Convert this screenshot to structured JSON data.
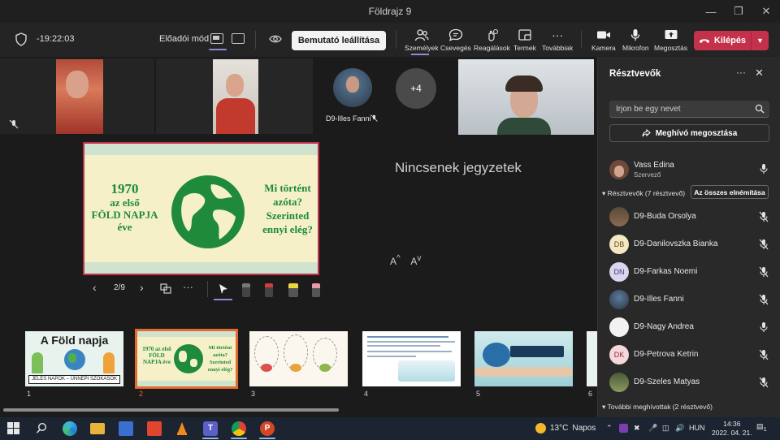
{
  "window": {
    "title": "Földrajz 9",
    "controls": [
      "minimize-icon",
      "restore-icon",
      "close-icon"
    ]
  },
  "toolbar": {
    "timer": "-19:22:03",
    "presenter_mode_label": "Előadói mód",
    "stop_presenting": "Bemutató leállítása",
    "items": [
      {
        "icon": "people-icon",
        "label": "Személyek"
      },
      {
        "icon": "chat-icon",
        "label": "Csevegés"
      },
      {
        "icon": "reactions-icon",
        "label": "Reagálások"
      },
      {
        "icon": "rooms-icon",
        "label": "Termek"
      },
      {
        "icon": "more-icon",
        "label": "Továbbiak"
      },
      {
        "icon": "camera-icon",
        "label": "Kamera"
      },
      {
        "icon": "microphone-icon",
        "label": "Mikrofon"
      },
      {
        "icon": "share-icon",
        "label": "Megosztás"
      }
    ],
    "leave_label": "Kilépés"
  },
  "stage": {
    "overflow_count": "+4",
    "featured_participant": "D9-Illes Fanni",
    "notes_empty": "Nincsenek jegyzetek",
    "font_increase": "A",
    "font_decrease": "A",
    "slide_counter": "2/9",
    "current_slide": {
      "left_lines": [
        "1970",
        "az első",
        "FÖLD NAPJA",
        "éve"
      ],
      "right_lines": [
        "Mi történt",
        "azóta?",
        "Szerinted",
        "ennyi elég?"
      ]
    },
    "thumbnails": [
      {
        "num": "1",
        "title": "A Föld napja",
        "subtitle": "JELES NAPOK – ÜNNEPI SZOKÁSOK"
      },
      {
        "num": "2",
        "left": "1970 az első FÖLD NAPJA éve",
        "right": "Mi történt azóta? Szerinted ennyi elég?"
      },
      {
        "num": "3"
      },
      {
        "num": "4"
      },
      {
        "num": "5"
      },
      {
        "num": "6"
      }
    ]
  },
  "panel": {
    "title": "Résztvevők",
    "search_placeholder": "Írjon be egy nevet",
    "share_invite": "Meghívó megosztása",
    "organizer": {
      "name": "Vass Edina",
      "role": "Szervező"
    },
    "attendees_header": "Résztvevők (7 résztvevő)",
    "mute_all": "Az összes elnémítása",
    "attendees": [
      {
        "name": "D9-Buda Orsolya",
        "initials": "",
        "mic": "off"
      },
      {
        "name": "D9-Danilovszka Bianka",
        "initials": "DB",
        "mic": "off"
      },
      {
        "name": "D9-Farkas Noemi",
        "initials": "DN",
        "mic": "off"
      },
      {
        "name": "D9-Illes Fanni",
        "initials": "",
        "mic": "off"
      },
      {
        "name": "D9-Nagy Andrea",
        "initials": "",
        "mic": "on"
      },
      {
        "name": "D9-Petrova Ketrin",
        "initials": "DK",
        "mic": "off"
      },
      {
        "name": "D9-Szeles Matyas",
        "initials": "",
        "mic": "off"
      }
    ],
    "others_header": "További meghívottak (2 résztvevő)"
  },
  "taskbar": {
    "weather": {
      "temp": "13°C",
      "condition": "Napos"
    },
    "language": "HUN",
    "time": "14:36",
    "date": "2022. 04. 21.",
    "notification_count": "1"
  },
  "colors": {
    "accent": "#8b8cd8",
    "leave": "#c4314b",
    "slide_green": "#1e8a3a",
    "slide_bg": "#f5f0c8"
  }
}
